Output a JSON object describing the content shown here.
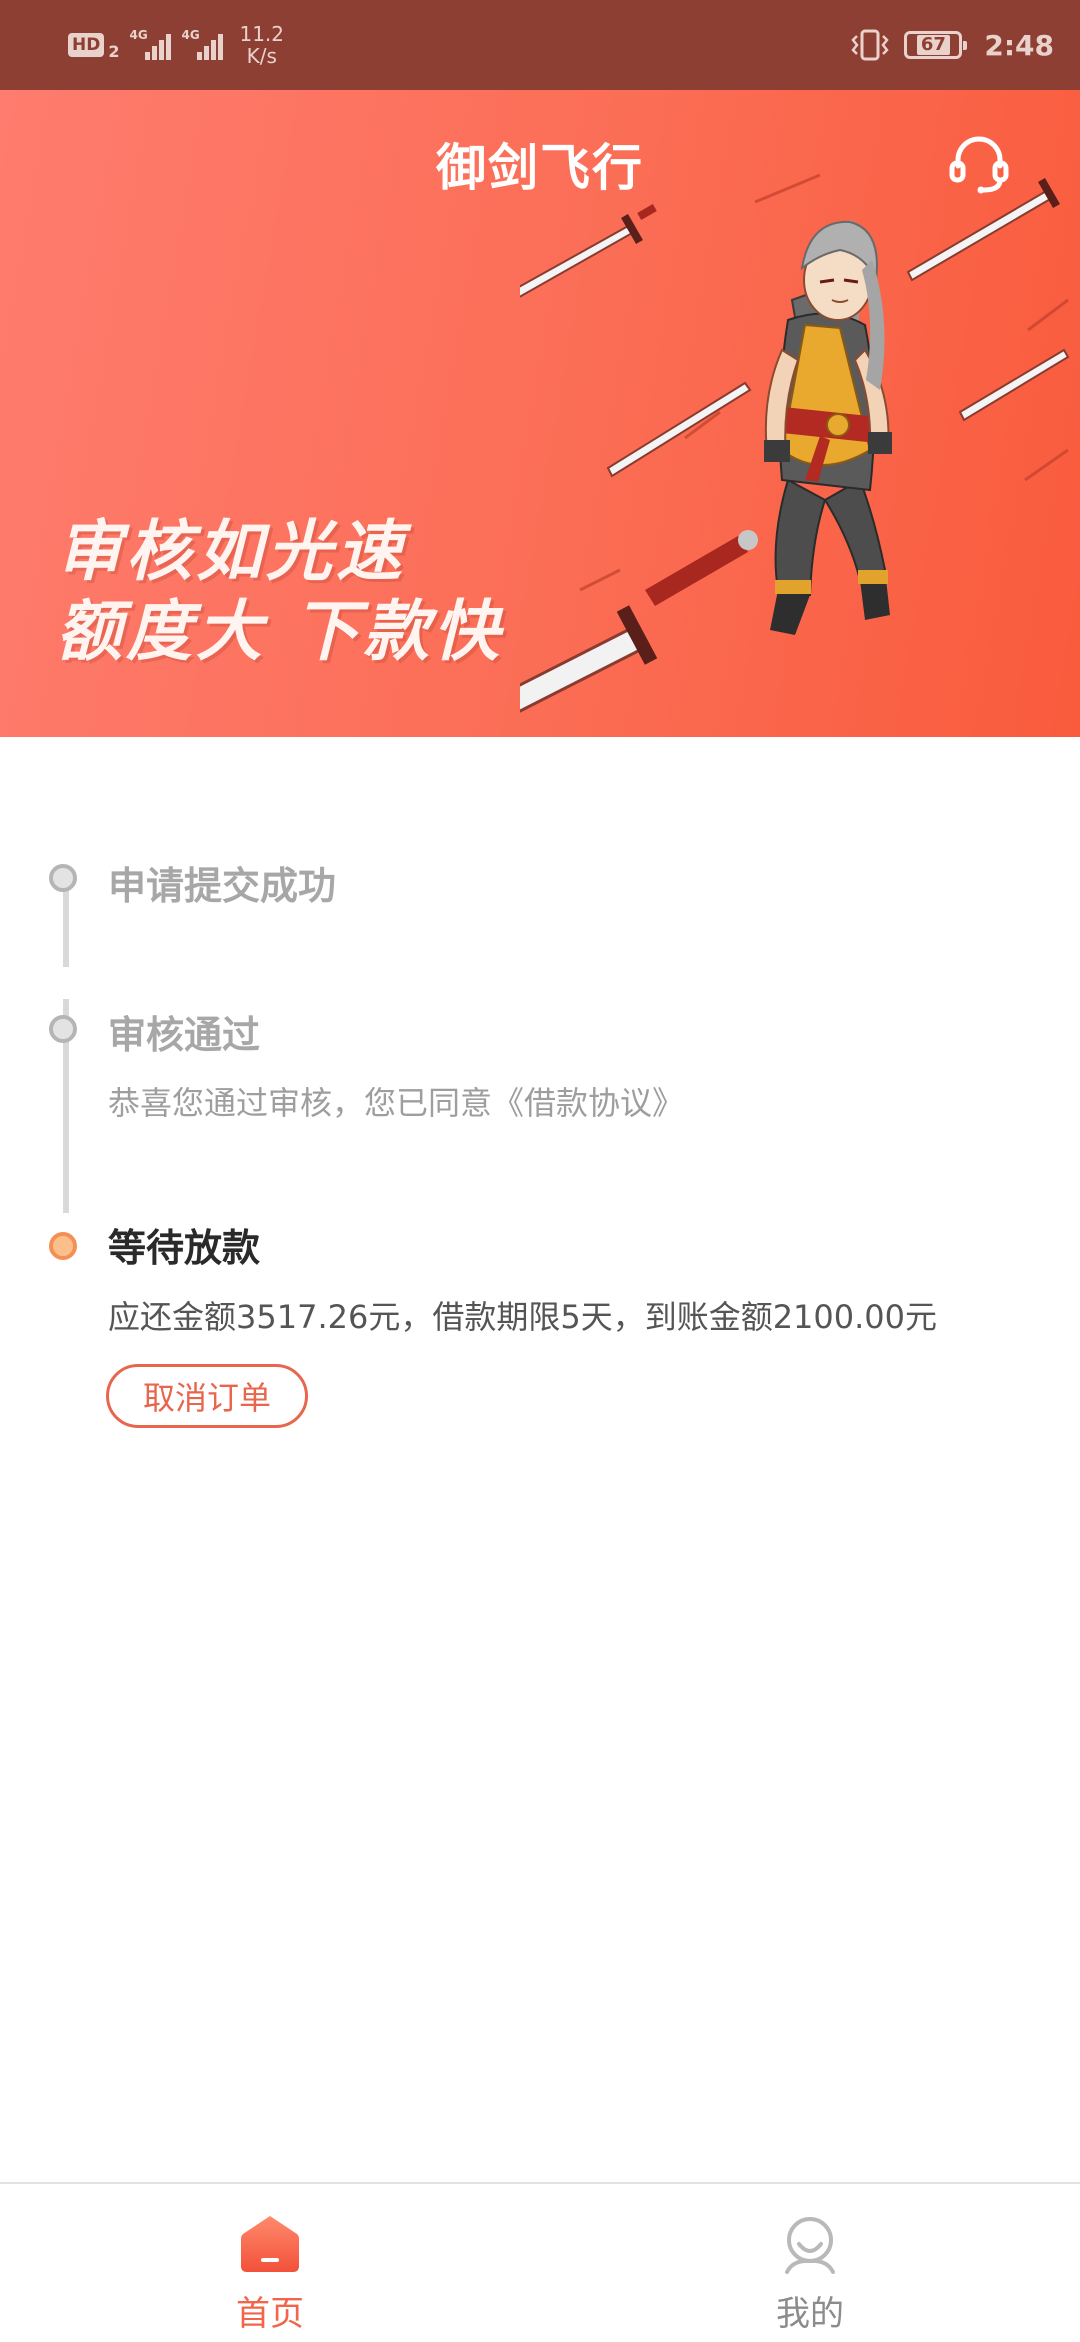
{
  "status_bar": {
    "hd_label": "HD",
    "hd_sim": "2",
    "network_1": "4G",
    "network_2": "4G",
    "speed_value": "11.2",
    "speed_unit": "K/s",
    "battery": "67",
    "time": "2:48"
  },
  "header": {
    "title": "御剑飞行",
    "support_icon": "headset-icon",
    "slogan_line1": "审核如光速",
    "slogan_line2": "额度大 下款快"
  },
  "timeline": {
    "steps": [
      {
        "title": "申请提交成功",
        "status": "done"
      },
      {
        "title": "审核通过",
        "desc": "恭喜您通过审核，您已同意《借款协议》",
        "status": "done"
      },
      {
        "title": "等待放款",
        "desc": "应还金额3517.26元，借款期限5天，到账金额2100.00元",
        "status": "current",
        "action": "取消订单"
      }
    ]
  },
  "bottom_nav": {
    "items": [
      {
        "label": "首页",
        "icon": "home-icon",
        "active": true
      },
      {
        "label": "我的",
        "icon": "profile-icon",
        "active": false
      }
    ]
  },
  "colors": {
    "accent": "#f2654a",
    "status_bar": "#8e3f33",
    "banner_start": "#ff7c6e",
    "banner_end": "#f95b3c",
    "current_dot": "#f58f55",
    "done_dot": "#b5b5b5"
  }
}
